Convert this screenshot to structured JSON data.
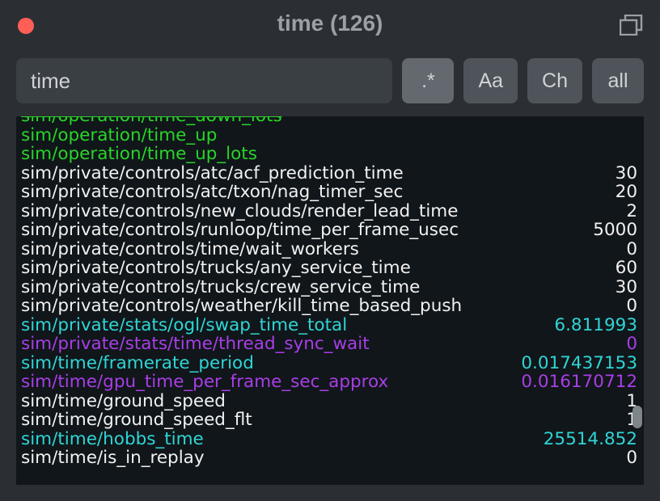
{
  "window": {
    "title": "time (126)"
  },
  "toolbar": {
    "search_value": "time",
    "regex_label": ".*",
    "case_label": "Aa",
    "ch_label": "Ch",
    "all_label": "all"
  },
  "rows": [
    {
      "path": "sim/operation/time_down_lots",
      "value": "",
      "color": "green",
      "cutoff": true
    },
    {
      "path": "sim/operation/time_up",
      "value": "",
      "color": "green"
    },
    {
      "path": "sim/operation/time_up_lots",
      "value": "",
      "color": "green"
    },
    {
      "path": "sim/private/controls/atc/acf_prediction_time",
      "value": "30",
      "color": "white"
    },
    {
      "path": "sim/private/controls/atc/txon/nag_timer_sec",
      "value": "20",
      "color": "white"
    },
    {
      "path": "sim/private/controls/new_clouds/render_lead_time",
      "value": "2",
      "color": "white"
    },
    {
      "path": "sim/private/controls/runloop/time_per_frame_usec",
      "value": "5000",
      "color": "white"
    },
    {
      "path": "sim/private/controls/time/wait_workers",
      "value": "0",
      "color": "white"
    },
    {
      "path": "sim/private/controls/trucks/any_service_time",
      "value": "60",
      "color": "white"
    },
    {
      "path": "sim/private/controls/trucks/crew_service_time",
      "value": "30",
      "color": "white"
    },
    {
      "path": "sim/private/controls/weather/kill_time_based_push",
      "value": "0",
      "color": "white"
    },
    {
      "path": "sim/private/stats/ogl/swap_time_total",
      "value": "6.811993",
      "color": "cyan"
    },
    {
      "path": "sim/private/stats/time/thread_sync_wait",
      "value": "0",
      "color": "purple"
    },
    {
      "path": "sim/time/framerate_period",
      "value": "0.017437153",
      "color": "cyan"
    },
    {
      "path": "sim/time/gpu_time_per_frame_sec_approx",
      "value": "0.016170712",
      "color": "purple"
    },
    {
      "path": "sim/time/ground_speed",
      "value": "1",
      "color": "white"
    },
    {
      "path": "sim/time/ground_speed_flt",
      "value": "1",
      "color": "white"
    },
    {
      "path": "sim/time/hobbs_time",
      "value": "25514.852",
      "color": "cyan"
    },
    {
      "path": "sim/time/is_in_replay",
      "value": "0",
      "color": "white"
    }
  ]
}
